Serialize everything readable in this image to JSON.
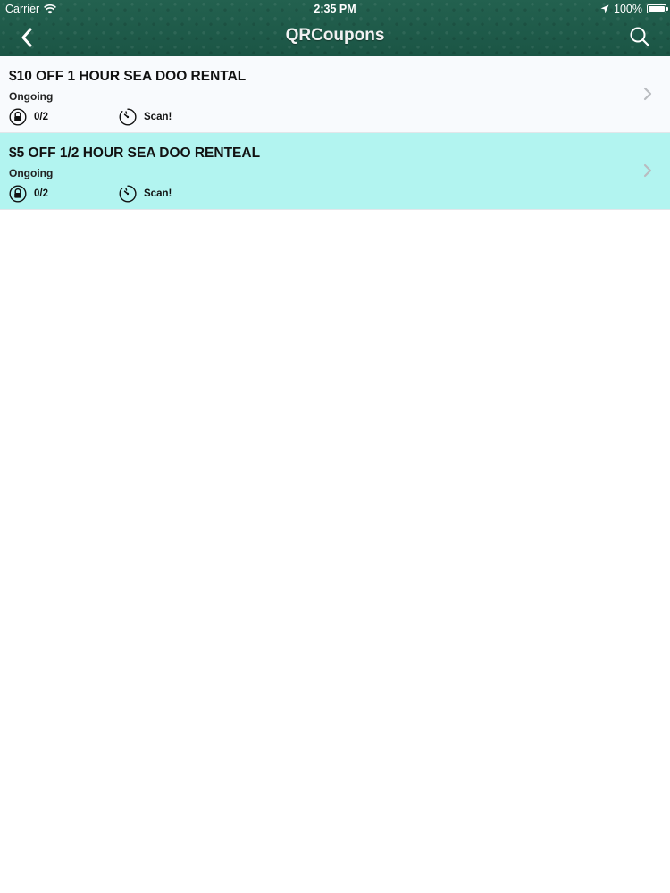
{
  "status_bar": {
    "carrier": "Carrier",
    "time": "2:35 PM",
    "battery": "100%",
    "battery_level": 1.0
  },
  "nav": {
    "title": "QRCoupons",
    "back_icon": "chevron-left-icon",
    "search_icon": "search-icon"
  },
  "colors": {
    "header": "#1f5a4c",
    "row_default": "#f8fafd",
    "row_selected": "#b2f4f0"
  },
  "coupons": [
    {
      "title": "$10 OFF 1 HOUR SEA DOO RENTAL",
      "status": "Ongoing",
      "usage": "0/2",
      "action": "Scan!",
      "selected": false
    },
    {
      "title": "$5 OFF 1/2 HOUR SEA DOO RENTEAL",
      "status": "Ongoing",
      "usage": "0/2",
      "action": "Scan!",
      "selected": true
    }
  ]
}
